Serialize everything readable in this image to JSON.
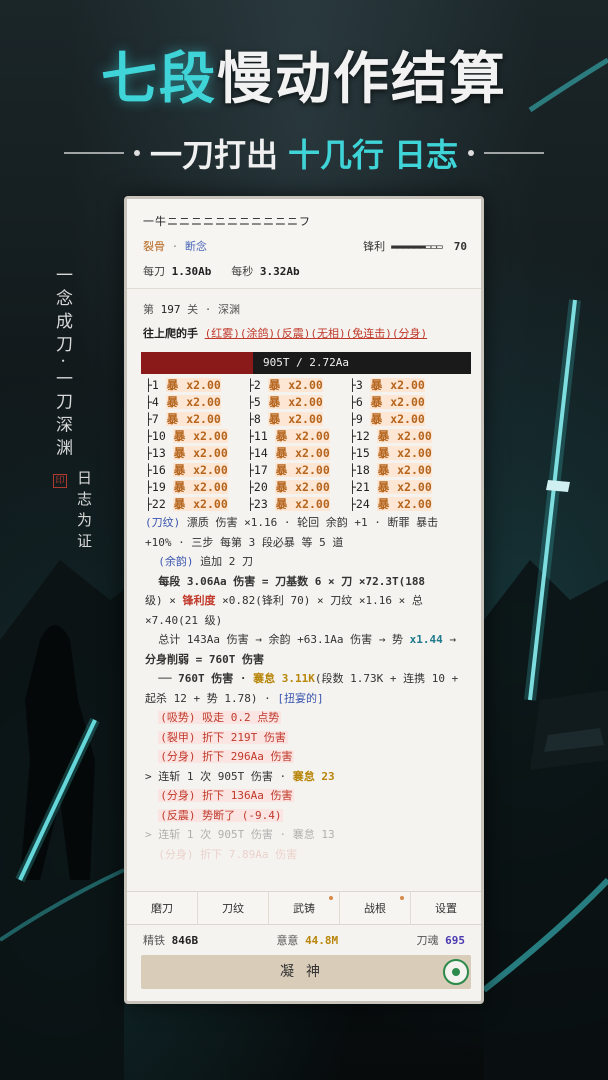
{
  "headline": {
    "accent": "七段",
    "rest": "慢动作结算"
  },
  "subline": {
    "part1": "一刀打出",
    "part2": "十几行",
    "part3": "日志"
  },
  "poem_left": "一念成刀·一刀深渊",
  "poem_right": "日志为证",
  "seal_text": "印",
  "weapon": {
    "name": "一牛ニニニニニニニニニニニフ",
    "tag1": "裂骨",
    "tag_sep": "·",
    "tag2": "断念",
    "sharp_label": "锋利",
    "sharp_bar": "▬▬▬▬▬▬▭▭▭",
    "sharp_value": "70",
    "per_slash_label": "每刀",
    "per_slash_value": "1.30Ab",
    "per_sec_label": "每秒",
    "per_sec_value": "3.32Ab"
  },
  "stage": {
    "prefix": "第",
    "number": "197",
    "suffix": "关 · 深渊",
    "enemy_name": "往上爬的手",
    "enemy_traits": "(红雾)(涂鸽)(反震)(无相)(免连击)(分身)"
  },
  "hp": {
    "text": "905T / 2.72Aa",
    "fill_fraction": 0.34
  },
  "grid": [
    [
      "├1 暴 x2.00",
      "├2 暴 x2.00",
      "├3 暴 x2.00"
    ],
    [
      "├4 暴 x2.00",
      "├5 暴 x2.00",
      "├6 暴 x2.00"
    ],
    [
      "├7 暴 x2.00",
      "├8 暴 x2.00",
      "├9 暴 x2.00"
    ],
    [
      "├10 暴 x2.00",
      "├11 暴 x2.00",
      "├12 暴 x2.00"
    ],
    [
      "├13 暴 x2.00",
      "├14 暴 x2.00",
      "├15 暴 x2.00"
    ],
    [
      "├16 暴 x2.00",
      "├17 暴 x2.00",
      "├18 暴 x2.00"
    ],
    [
      "├19 暴 x2.00",
      "├20 暴 x2.00",
      "├21 暴 x2.00"
    ],
    [
      "├22 暴 x2.00",
      "├23 暴 x2.00",
      "├24 暴 x2.00"
    ]
  ],
  "log": {
    "l1a": "(刀纹)",
    "l1b": " 漂质 伤害 ×1.16 · 轮回 余韵 +1 · 断罪 暴击",
    "l1c": "+10% · 三步 每第 3 段必暴 等 5 道",
    "l2a": "(余韵)",
    "l2b": " 追加 2 刀",
    "l3": "每段 3.06Aa 伤害 = 刀基数 6 × 刀 ×72.3T(188",
    "l3b": "级) × ",
    "l3c": "锋利度",
    "l3d": " ×0.82(锋利 70) × 刀纹 ×1.16 × 总",
    "l3e": "×7.40(21 级)",
    "l4a": "总计 143Aa 伤害 → 余韵 +63.1Aa 伤害 → 势 ",
    "l4b": "x1.44",
    "l4c": " →",
    "l4d": "分身削弱 = 760T 伤害",
    "l5a": "── 760T 伤害 · ",
    "l5b": "褰怠 3.11K",
    "l5c": "(段数 1.73K + 连携 10 +",
    "l5d": "起杀 12 + 势 1.78) · ",
    "l5e": "[扭宴的]",
    "l6": "(吸势) 吸走 0.2 点势",
    "l7": "(裂甲) 折下 219T 伤害",
    "l8": "(分身) 折下 296Aa 伤害",
    "l9a": "> 连斩 1 次  905T 伤害 · ",
    "l9b": "褰怠 23",
    "l10": "(分身) 折下 136Aa 伤害",
    "l11": "(反震) 势断了 (-9.4)",
    "l12": "> 连斩 1 次  905T 伤害 · 褰怠 13",
    "l13": "(分身) 折下 7.89Aa 伤害"
  },
  "tabs": [
    {
      "label": "磨刀"
    },
    {
      "label": "刀纹"
    },
    {
      "label": "武铸"
    },
    {
      "label": "战根"
    },
    {
      "label": "设置"
    }
  ],
  "resources": {
    "iron_label": "精铁",
    "iron_value": "846B",
    "intent_label": "意意",
    "intent_value": "44.8M",
    "soul_label": "刀魂",
    "soul_value": "695"
  },
  "ningshen_label": "凝神",
  "colors": {
    "accent": "#3fd5d8",
    "panel": "#f5f3ef",
    "hp_fill": "#8a1a1a"
  }
}
